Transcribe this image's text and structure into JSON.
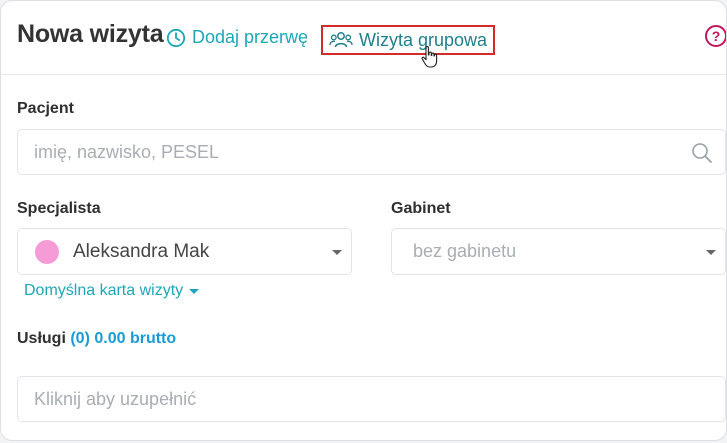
{
  "header": {
    "title": "Nowa wizyta",
    "add_break_label": "Dodaj przerwę",
    "group_visit_label": "Wizyta grupowa",
    "help_label": "?"
  },
  "patient": {
    "label": "Pacjent",
    "placeholder": "imię, nazwisko, PESEL"
  },
  "specialist": {
    "label": "Specjalista",
    "value": "Aleksandra Mak",
    "color": "#f59bd6"
  },
  "room": {
    "label": "Gabinet",
    "value": "bez gabinetu"
  },
  "default_card_link": "Domyślna karta wizyty",
  "services": {
    "label": "Usługi",
    "count": "(0)",
    "price": "0.00 brutto",
    "placeholder": "Kliknij aby uzupełnić"
  },
  "colors": {
    "accent": "#1ca7b8",
    "highlight_border": "#d22b2b",
    "help": "#c2185b",
    "price": "#1b9ad6"
  }
}
